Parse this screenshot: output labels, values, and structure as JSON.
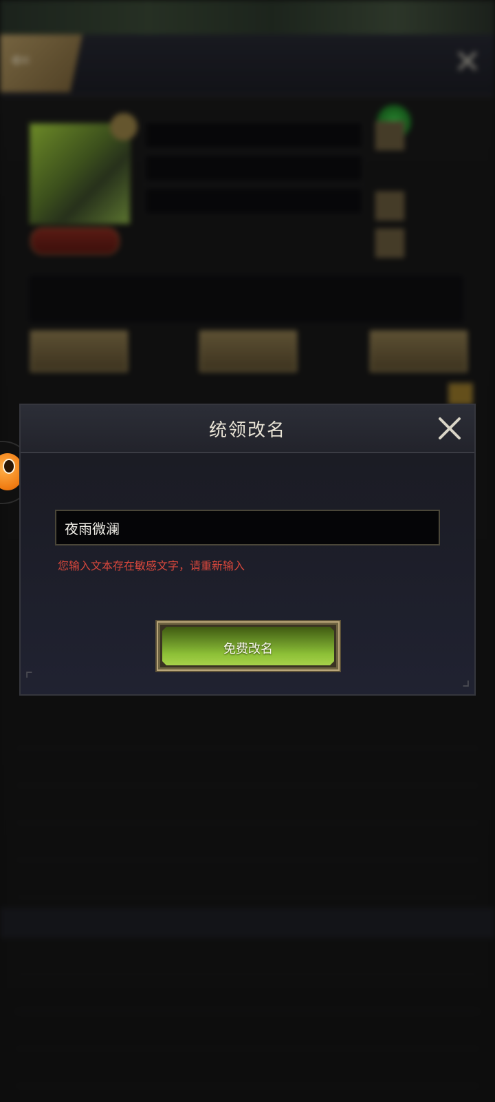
{
  "modal": {
    "title": "统领改名",
    "name_input_value": "夜雨微澜",
    "error_message": "您输入文本存在敏感文字，请重新输入",
    "rename_button_label": "免费改名",
    "close_icon": "close-icon"
  },
  "colors": {
    "error": "#d8473c",
    "button_green": "#8cbf36",
    "modal_bg": "#1c1d27"
  }
}
